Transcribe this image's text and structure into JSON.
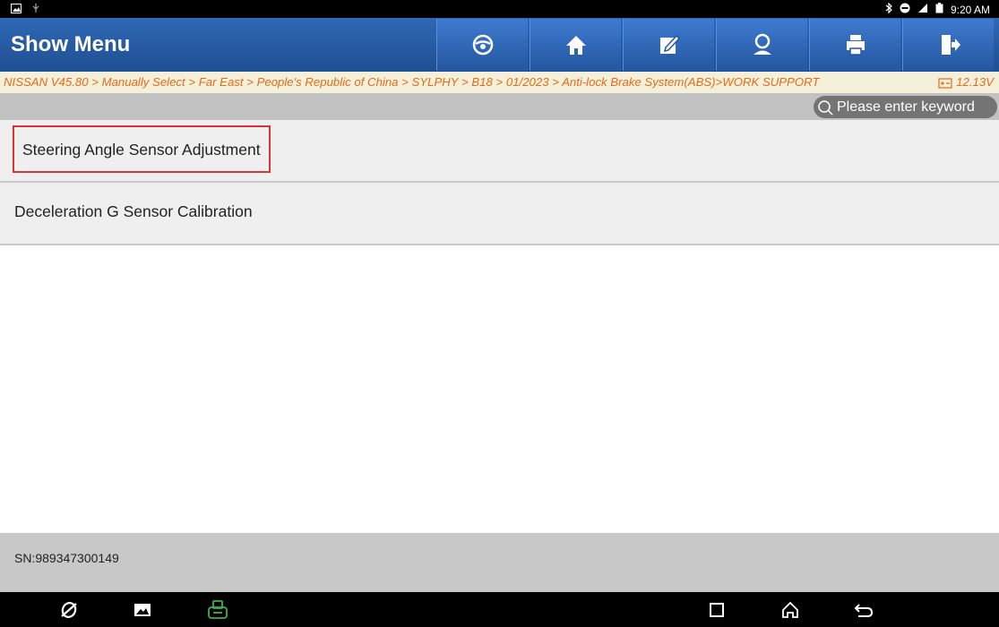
{
  "status_bar": {
    "time": "9:20 AM",
    "left_icons": [
      "image-icon",
      "usb-icon"
    ],
    "right_icons": [
      "bluetooth-icon",
      "dnd-icon",
      "signal-icon",
      "battery-icon"
    ]
  },
  "header": {
    "title": "Show Menu",
    "toolbar": [
      {
        "name": "steering-wheel-icon"
      },
      {
        "name": "home-icon"
      },
      {
        "name": "edit-icon"
      },
      {
        "name": "user-icon"
      },
      {
        "name": "print-icon"
      },
      {
        "name": "exit-icon"
      }
    ],
    "accent_color": "#2556a0"
  },
  "breadcrumb": {
    "path": "NISSAN V45.80 > Manually Select > Far East > People's Republic of China > SYLPHY > B18 > 01/2023 > Anti-lock Brake System(ABS)>WORK SUPPORT",
    "voltage": "12.13V"
  },
  "search": {
    "placeholder": "Please enter keyword"
  },
  "menu": {
    "items": [
      {
        "label": "Steering Angle Sensor Adjustment"
      },
      {
        "label": "Deceleration G Sensor Calibration"
      }
    ]
  },
  "footer": {
    "serial": "SN:989347300149"
  },
  "nav_bar": {
    "icons": [
      "browser-icon",
      "gallery-icon",
      "vci-icon",
      "recent-apps-icon",
      "home-nav-icon",
      "back-icon"
    ],
    "vci_color": "#3bb34a"
  }
}
